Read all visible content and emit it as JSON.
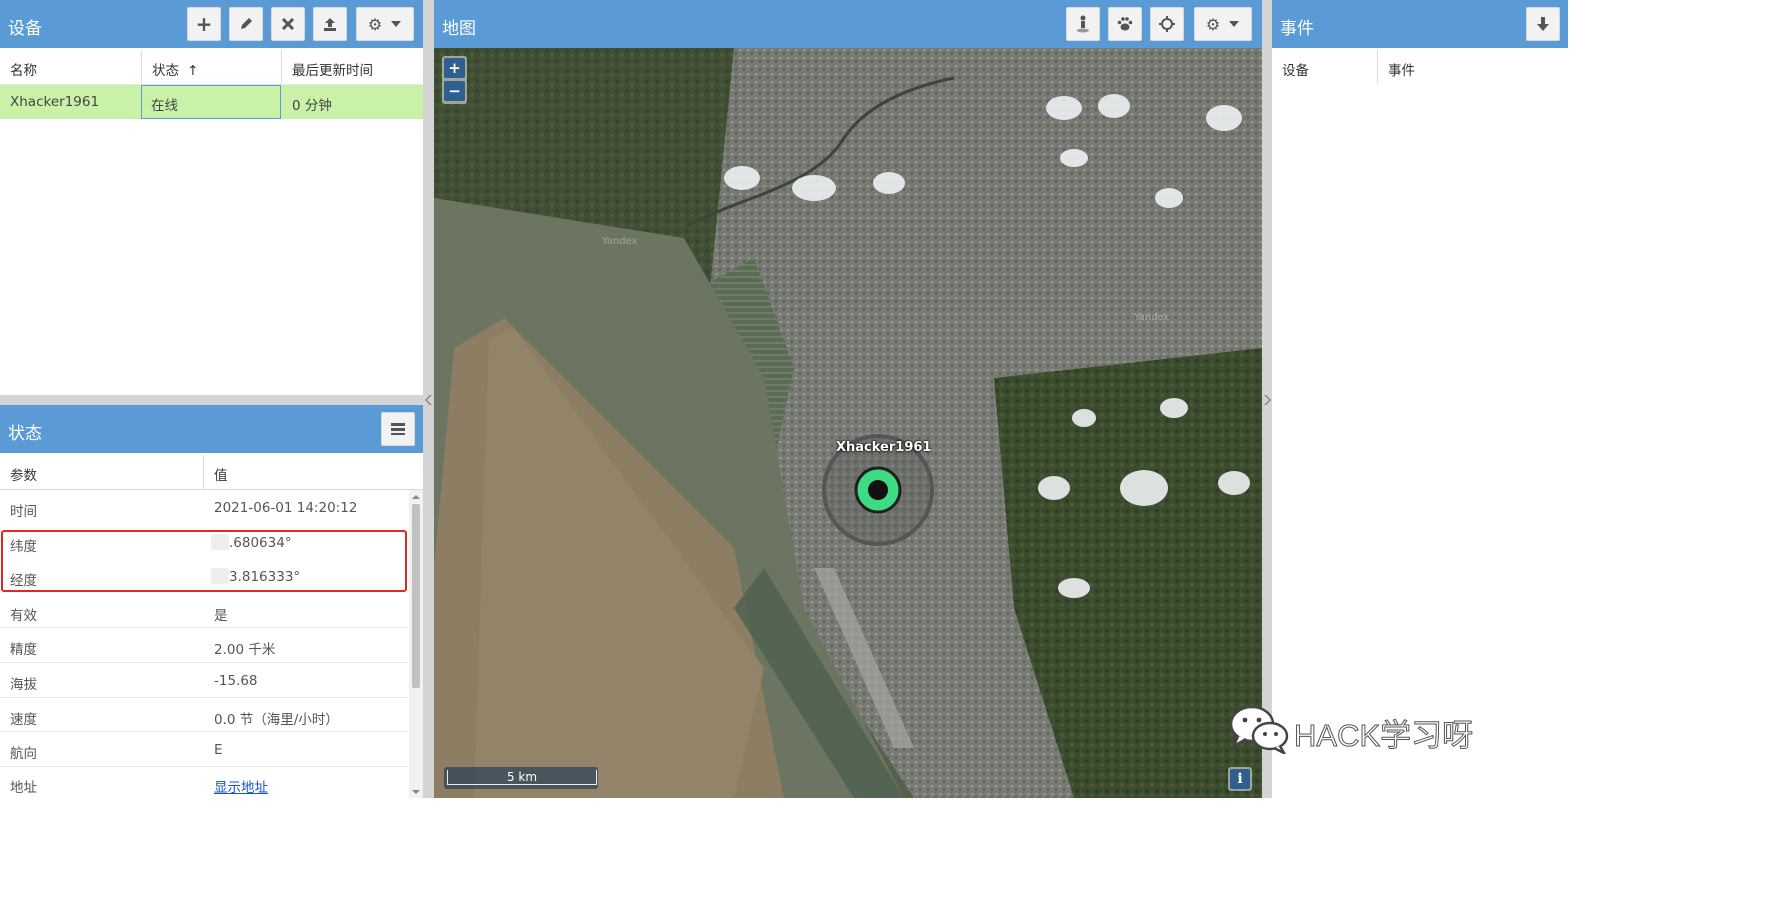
{
  "devices": {
    "title": "设备",
    "columns": [
      "名称",
      "状态",
      "最后更新时间"
    ],
    "sort_indicator": "↑",
    "rows": [
      {
        "name": "Xhacker1961",
        "status": "在线",
        "updated": "0 分钟"
      }
    ],
    "toolbar_icons": [
      "add-icon",
      "edit-icon",
      "remove-icon",
      "upload-icon",
      "gear-icon",
      "caret-down-icon"
    ],
    "row_highlight": "#c9f2a8"
  },
  "status": {
    "title": "状态",
    "columns": [
      "参数",
      "值"
    ],
    "rows": [
      {
        "param": "时间",
        "value": "2021-06-01 14:20:12"
      },
      {
        "param": "纬度",
        "value": ".680634°"
      },
      {
        "param": "经度",
        "value": "3.816333°"
      },
      {
        "param": "有效",
        "value": "是"
      },
      {
        "param": "精度",
        "value": "2.00 千米"
      },
      {
        "param": "海拔",
        "value": "-15.68"
      },
      {
        "param": "速度",
        "value": "0.0 节（海里/小时）"
      },
      {
        "param": "航向",
        "value": "E"
      },
      {
        "param": "地址",
        "value": "显示地址"
      }
    ],
    "highlight_color": "#e32626"
  },
  "map": {
    "title": "地图",
    "zoom_in": "+",
    "zoom_out": "−",
    "marker_label": "Xhacker1961",
    "scale": "5 km",
    "info": "i",
    "tile_labels": [
      "Yandex",
      "Yandex"
    ],
    "toolbar_icons": [
      "person-icon",
      "paw-icon",
      "crosshair-icon",
      "gear-icon",
      "caret-down-icon"
    ],
    "marker_color": "#3ddc84"
  },
  "events": {
    "title": "事件",
    "columns": [
      "设备",
      "事件"
    ],
    "toolbar_icons": [
      "download-icon"
    ]
  },
  "watermark": {
    "text": "HACK学习呀"
  },
  "colors": {
    "header": "#5b9bd5",
    "gutter": "#d4d4d4"
  }
}
